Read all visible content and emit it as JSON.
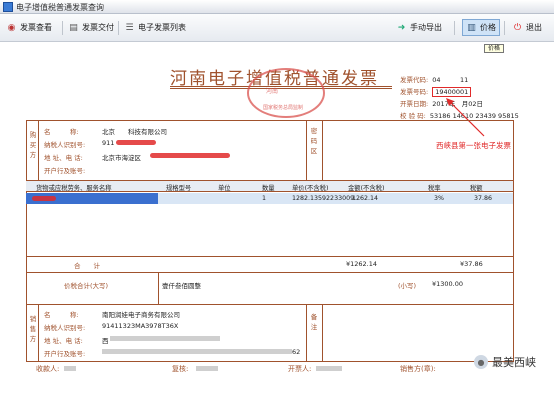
{
  "window": {
    "title": "电子增值税普通发票查询"
  },
  "toolbar": {
    "view_label": "发票查看",
    "deliver_label": "发票交付",
    "list_label": "电子发票列表",
    "export_label": "手动导出",
    "price_label": "价格",
    "exit_label": "退出",
    "tooltip": "价格"
  },
  "invoice": {
    "title": "河南电子增值税普通发票",
    "seal_text_top": "河南",
    "seal_text_bottom": "国家税务总局监制",
    "code_label": "发票代码:",
    "code_value": "04   11",
    "number_label": "发票号码:",
    "number_value": "19400001",
    "date_label": "开票日期:",
    "date_value": "2017年 月02日",
    "check_label": "校 验 码:",
    "check_value": "53186 14610 23439 95815",
    "annotation": "西峡县第一张电子发票",
    "buyer": {
      "side_label": "购买方",
      "name_label": "名   称:",
      "name_value": "北京  科技有限公司",
      "tax_label": "纳税人识别号:",
      "tax_value": "911",
      "addr_label": "地 址、电 话:",
      "addr_value": "北京市海淀区",
      "bank_label": "开户行及账号:"
    },
    "password_label": "密码区",
    "items": {
      "headers": [
        "货物或应税劳务、服务名称",
        "规格型号",
        "单位",
        "数量",
        "单价(不含税)",
        "金额(不含税)",
        "税率",
        "税额"
      ],
      "row": [
        "",
        "",
        "",
        "1",
        "1282.13592233009...",
        "1262.14",
        "3%",
        "37.86"
      ]
    },
    "total": {
      "label": "合  计",
      "amount": "¥1262.14",
      "tax": "¥37.86"
    },
    "total_words": {
      "label": "价税合计(大写)",
      "value": "壹仟叁佰圆整",
      "small_label": "(小写)",
      "small_value": "¥1300.00"
    },
    "seller": {
      "side_label": "销售方",
      "name_label": "名   称:",
      "name_value": "南阳润娃电子商务有限公司",
      "tax_label": "纳税人识别号:",
      "tax_value": "91411323MA3978T36X",
      "addr_label": "地 址、电 话:",
      "addr_value": "西",
      "bank_label": "开户行及账号:",
      "bank_value": "62"
    },
    "remark_label": "备注",
    "footer": {
      "payee_label": "收款人:",
      "review_label": "复核:",
      "drawer_label": "开票人:",
      "seller_label": "销售方(章):"
    }
  },
  "watermark": "最美西峡",
  "colors": {
    "accent": "#a0522d",
    "annotation": "#e02a2a",
    "selection": "#3a6fcf"
  }
}
